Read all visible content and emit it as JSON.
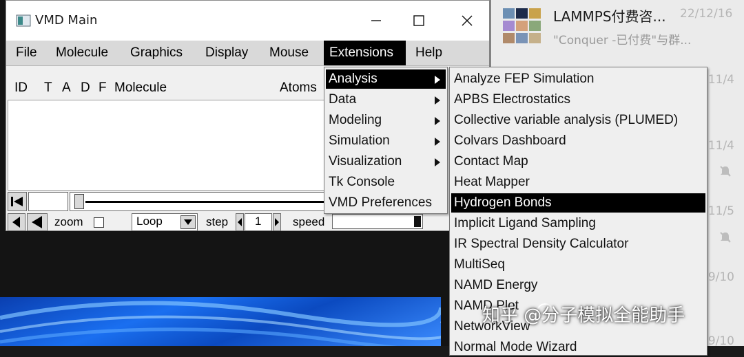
{
  "window": {
    "title": "VMD Main",
    "controls": {
      "minimize": "─",
      "maximize": "☐",
      "close": "✕"
    }
  },
  "menubar": [
    "File",
    "Molecule",
    "Graphics",
    "Display",
    "Mouse",
    "Extensions",
    "Help"
  ],
  "active_menu": "Extensions",
  "molecule_list": {
    "headers": {
      "id": "ID",
      "t": "T",
      "a": "A",
      "d": "D",
      "f": "F",
      "molecule": "Molecule",
      "atoms": "Atoms"
    }
  },
  "animation": {
    "zoom_label": "zoom",
    "loop_mode": "Loop",
    "step_label": "step",
    "step_value": "1",
    "speed_label": "speed"
  },
  "extensions_menu": [
    {
      "label": "Analysis",
      "submenu": true
    },
    {
      "label": "Data",
      "submenu": true
    },
    {
      "label": "Modeling",
      "submenu": true
    },
    {
      "label": "Simulation",
      "submenu": true
    },
    {
      "label": "Visualization",
      "submenu": true
    },
    {
      "label": "Tk Console",
      "submenu": false
    },
    {
      "label": "VMD Preferences",
      "submenu": false
    }
  ],
  "analysis_submenu": [
    "Analyze FEP Simulation",
    "APBS Electrostatics",
    "Collective variable analysis (PLUMED)",
    "Colvars Dashboard",
    "Contact Map",
    "Heat Mapper",
    "Hydrogen Bonds",
    "Implicit Ligand Sampling",
    "IR Spectral Density Calculator",
    "MultiSeq",
    "NAMD Energy",
    "NAMD Plot",
    "NetworkView",
    "Normal Mode Wizard"
  ],
  "selected_analysis_item": "Hydrogen Bonds",
  "chat": {
    "title": "LAMMPS付费咨...",
    "date": "22/12/16",
    "preview": "\"Conquer -已付费\"与群...",
    "side_dates": [
      "11/4",
      "11/4",
      "11/5",
      "9/10",
      "9/10"
    ]
  },
  "watermark": "知乎 @分子模拟全能助手",
  "colors": {
    "menu_highlight": "#000000",
    "menu_bg": "#efefef",
    "chat_bg": "#ebebeb"
  }
}
